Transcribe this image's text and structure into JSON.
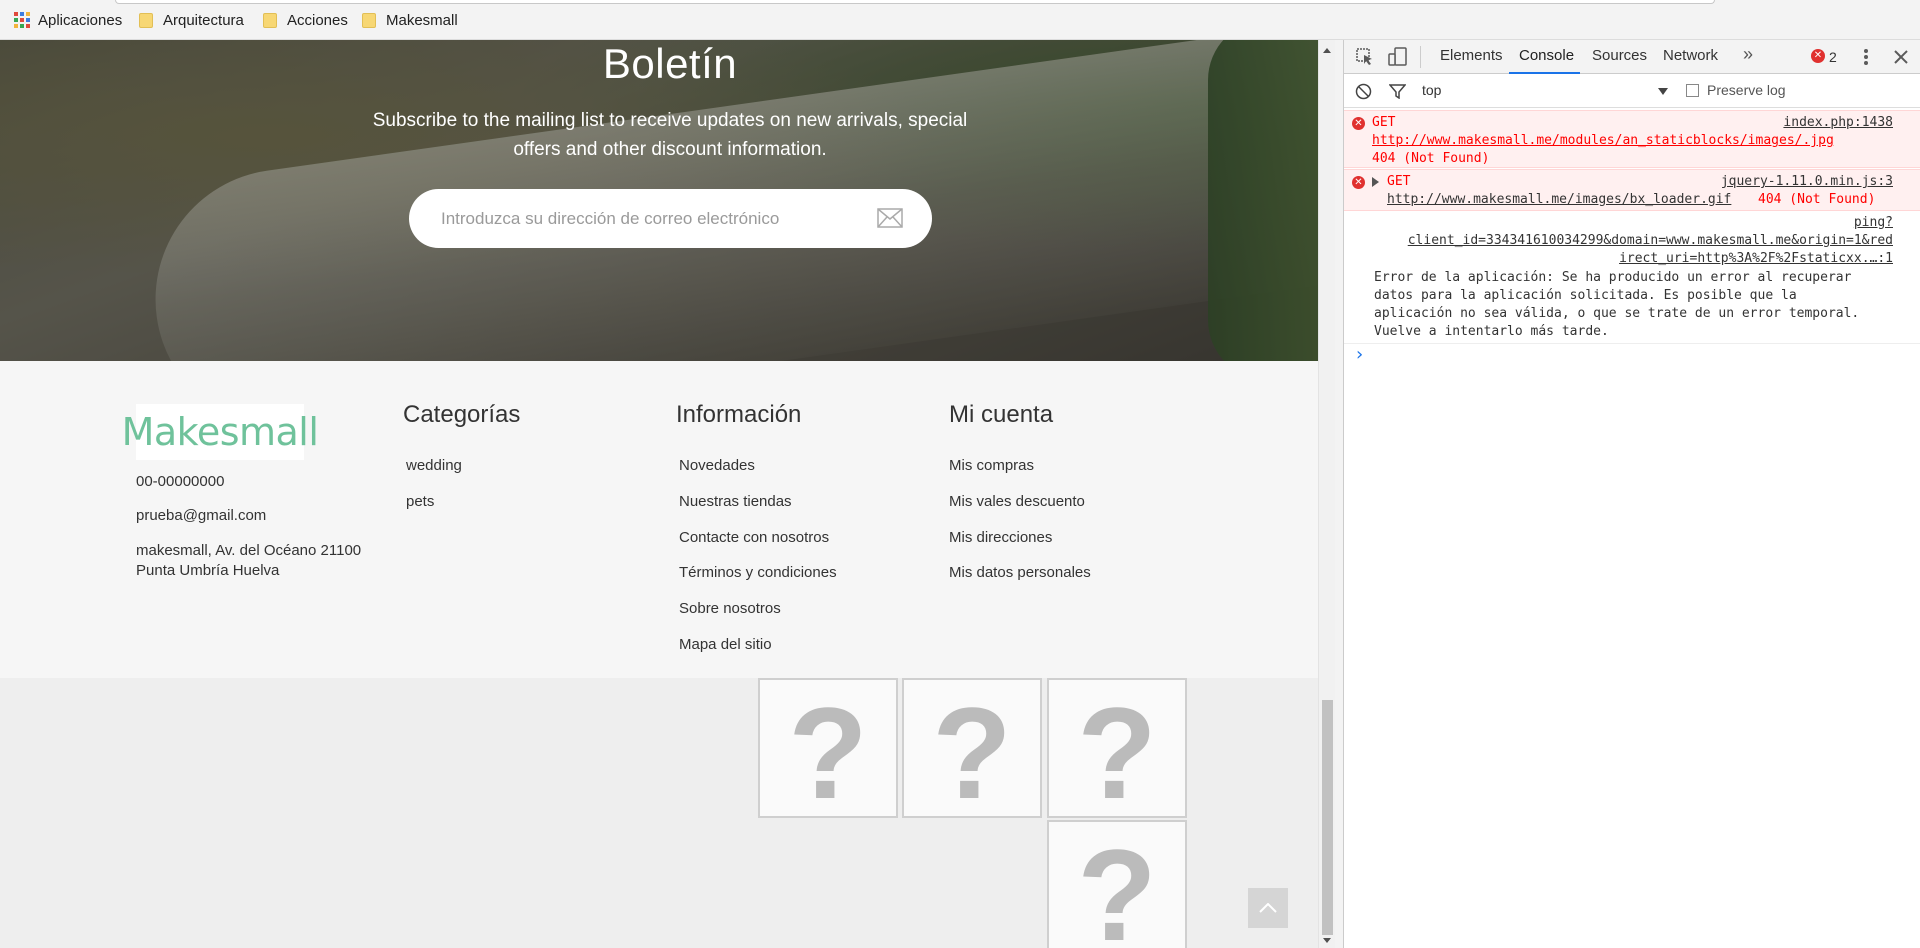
{
  "bookmarks": {
    "apps_label": "Aplicaciones",
    "items": [
      "Arquitectura",
      "Acciones",
      "Makesmall"
    ]
  },
  "hero": {
    "title": "Boletín",
    "text": "Subscribe to the mailing list to receive updates on new arrivals, special offers and other discount information.",
    "email_placeholder": "Introduzca su dirección de correo electrónico",
    "submit_icon": "envelope-icon"
  },
  "footer": {
    "logo": "Makesmall",
    "phone": "00-00000000",
    "email": "prueba@gmail.com",
    "address": "makesmall, Av. del Océano 21100 Punta Umbría Huelva",
    "columns": [
      {
        "title": "Categorías",
        "items": [
          "wedding",
          "pets"
        ]
      },
      {
        "title": "Información",
        "items": [
          "Novedades",
          "Nuestras tiendas",
          "Contacte con nosotros",
          "Términos y condiciones",
          "Sobre nosotros",
          "Mapa del sitio"
        ]
      },
      {
        "title": "Mi cuenta",
        "items": [
          "Mis compras",
          "Mis vales descuento",
          "Mis direcciones",
          "Mis datos personales"
        ]
      }
    ]
  },
  "broken_images": {
    "glyph": "?"
  },
  "devtools": {
    "tabs": [
      "Elements",
      "Console",
      "Sources",
      "Network"
    ],
    "active_tab": "Console",
    "more_label": "»",
    "error_count": "2",
    "context": "top",
    "preserve_log_label": "Preserve log",
    "messages": [
      {
        "method": "GET",
        "url": "http://www.makesmall.me/modules/an_staticblocks/images/.jpg",
        "status": "404 (Not Found)",
        "source": "index.php:1438"
      },
      {
        "method": "GET",
        "url": "http://www.makesmall.me/images/bx_loader.gif",
        "status": "404 (Not Found)",
        "source": "jquery-1.11.0.min.js:3"
      },
      {
        "source_line1": "ping?",
        "source_line2": "client_id=334341610034299&domain=www.makesmall.me&origin=1&red",
        "source_line3": "irect_uri=http%3A%2F%2Fstaticxx.…:1",
        "text_lines": [
          "Error de la aplicación: Se ha producido un error al recuperar",
          "datos para la aplicación solicitada. Es posible que la",
          "aplicación no sea válida, o que se trate de un error temporal.",
          "Vuelve a intentarlo más tarde."
        ]
      }
    ],
    "prompt": "›"
  },
  "colors": {
    "logo_green": "#6fc29b",
    "devtools_accent": "#1a73e8",
    "error_red": "#ff0000"
  }
}
